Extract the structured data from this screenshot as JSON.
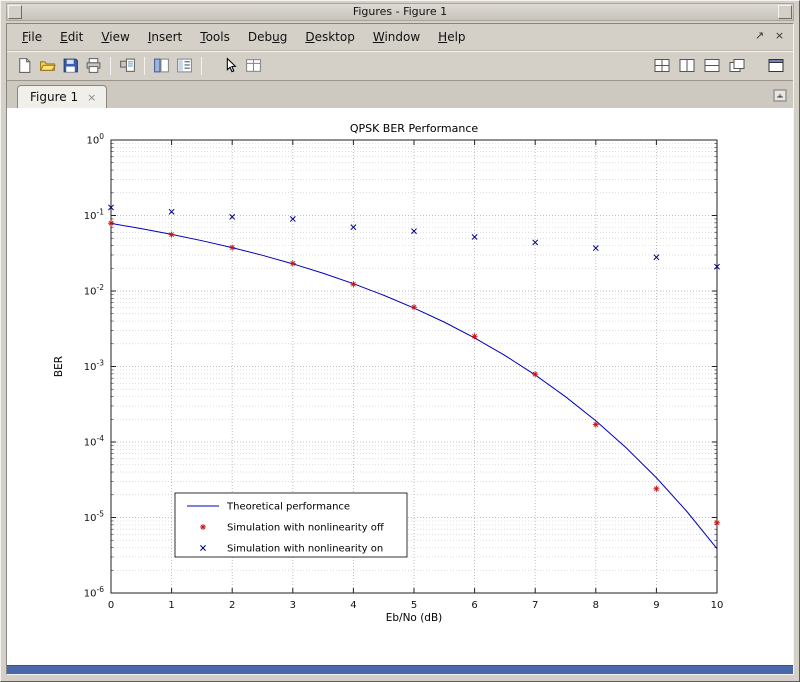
{
  "window": {
    "title": "Figures - Figure 1",
    "statusbar_color": "#4a69ad"
  },
  "menubar": {
    "items": [
      {
        "label": "File",
        "mnemonic_index": 0
      },
      {
        "label": "Edit",
        "mnemonic_index": 0
      },
      {
        "label": "View",
        "mnemonic_index": 0
      },
      {
        "label": "Insert",
        "mnemonic_index": 0
      },
      {
        "label": "Tools",
        "mnemonic_index": 0
      },
      {
        "label": "Debug",
        "mnemonic_index": 3
      },
      {
        "label": "Desktop",
        "mnemonic_index": 0
      },
      {
        "label": "Window",
        "mnemonic_index": 0
      },
      {
        "label": "Help",
        "mnemonic_index": 0
      }
    ],
    "right_icons": [
      {
        "name": "undock-icon",
        "glyph": "↗"
      },
      {
        "name": "close-icon",
        "glyph": "×"
      }
    ]
  },
  "toolbar": {
    "icons": [
      "new-figure",
      "open-file",
      "save-figure",
      "print-figure",
      "print-preview",
      "figure-palette",
      "plot-browser",
      "edit-plot",
      "property-editor"
    ],
    "window_icons": [
      "tile-windows",
      "tile-left-right",
      "tile-top-bottom",
      "float-windows",
      "maximize-window"
    ]
  },
  "tabbar": {
    "tabs": [
      {
        "label": "Figure 1",
        "close_glyph": "×"
      }
    ]
  },
  "chart_data": {
    "type": "line",
    "title": "QPSK BER Performance",
    "xlabel": "Eb/No (dB)",
    "ylabel": "BER",
    "xlim": [
      0,
      10
    ],
    "ylog": true,
    "ylim": [
      1e-06,
      1
    ],
    "ylim_exponents": [
      0,
      -6
    ],
    "xticks": [
      0,
      1,
      2,
      3,
      4,
      5,
      6,
      7,
      8,
      9,
      10
    ],
    "grid": true,
    "legend_position": "southwest-inside",
    "legend": [
      "Theoretical performance",
      "Simulation with nonlinearity off",
      "Simulation with nonlinearity on"
    ],
    "series": [
      {
        "name": "Theoretical performance",
        "type": "line",
        "color": "#0000bb",
        "x": [
          0,
          0.5,
          1,
          1.5,
          2,
          2.5,
          3,
          3.5,
          4,
          4.5,
          5,
          5.5,
          6,
          6.5,
          7,
          7.5,
          8,
          8.5,
          9,
          9.5,
          10
        ],
        "y": [
          0.0786,
          0.067,
          0.0563,
          0.0464,
          0.0375,
          0.0297,
          0.0229,
          0.0172,
          0.0125,
          0.00878,
          0.00595,
          0.00387,
          0.00239,
          0.0014,
          0.000773,
          0.000398,
          0.000191,
          8.4e-05,
          3.36e-05,
          1.21e-05,
          3.87e-06
        ]
      },
      {
        "name": "Simulation with nonlinearity off",
        "type": "marker",
        "marker": "asterisk",
        "color": "#cc1111",
        "x": [
          0,
          1,
          2,
          3,
          4,
          5,
          6,
          7,
          8,
          9,
          10
        ],
        "y": [
          0.079,
          0.0558,
          0.0376,
          0.0232,
          0.0123,
          0.0061,
          0.00251,
          0.00079,
          0.00017,
          2.4e-05,
          8.5e-06
        ]
      },
      {
        "name": "Simulation with nonlinearity on",
        "type": "marker",
        "marker": "x",
        "color": "#000080",
        "x": [
          0,
          1,
          2,
          3,
          4,
          5,
          6,
          7,
          8,
          9,
          10
        ],
        "y": [
          0.128,
          0.112,
          0.096,
          0.09,
          0.07,
          0.062,
          0.052,
          0.044,
          0.037,
          0.028,
          0.021
        ]
      }
    ]
  }
}
